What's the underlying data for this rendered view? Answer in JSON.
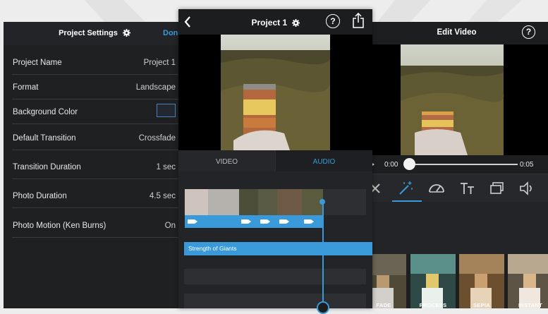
{
  "left_screen": {
    "title": "Project Settings",
    "done_label": "Done",
    "settings": [
      {
        "label": "Project Name",
        "value": "Project 1"
      },
      {
        "label": "Format",
        "value": "Landscape"
      },
      {
        "label": "Background Color",
        "value": ""
      },
      {
        "label": "Default Transition",
        "value": "Crossfade"
      },
      {
        "label": "Transition Duration",
        "value": "1 sec"
      },
      {
        "label": "Photo Duration",
        "value": "4.5 sec"
      },
      {
        "label": "Photo Motion (Ken Burns)",
        "value": "On"
      }
    ],
    "background_color_swatch": "#232730"
  },
  "center_screen": {
    "title": "Project 1",
    "tabs": [
      {
        "label": "VIDEO",
        "active": false
      },
      {
        "label": "AUDIO",
        "active": true
      }
    ],
    "audio_track_label": "Strength of Giants",
    "accent_color": "#3a9ad9"
  },
  "right_screen": {
    "title": "Edit Video",
    "time_start": "0:00",
    "time_end": "0:05",
    "scrub_progress": 0.0,
    "tools": [
      "trim-icon",
      "magic-wand-icon",
      "speed-gauge-icon",
      "text-icon",
      "overlay-icon",
      "volume-icon"
    ],
    "active_tool": "magic-wand-icon",
    "filters": [
      {
        "label": "FADE"
      },
      {
        "label": "PROCESS"
      },
      {
        "label": "SEPIA"
      },
      {
        "label": "INSTANT"
      }
    ]
  }
}
